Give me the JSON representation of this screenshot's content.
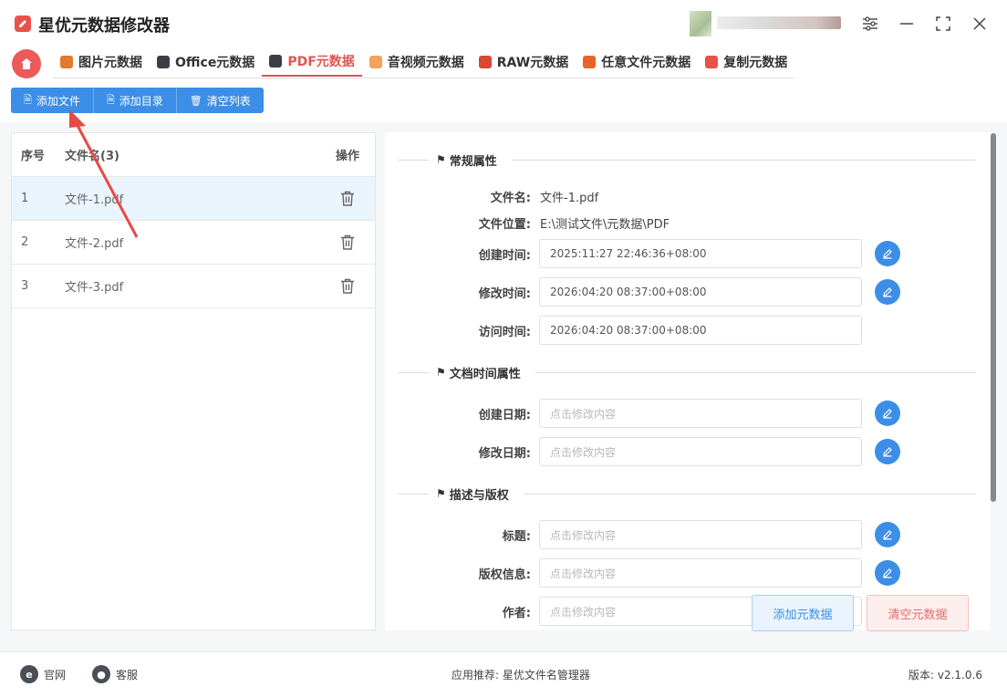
{
  "app": {
    "title": "星优元数据修改器",
    "brand_color": "#e9524a",
    "accent": "#3c8ee6"
  },
  "tabs": [
    {
      "label": "图片元数据",
      "icon": "image-icon",
      "active": false
    },
    {
      "label": "Office元数据",
      "icon": "office-icon",
      "active": false
    },
    {
      "label": "PDF元数据",
      "icon": "pdf-icon",
      "active": true
    },
    {
      "label": "音视频元数据",
      "icon": "media-icon",
      "active": false
    },
    {
      "label": "RAW元数据",
      "icon": "raw-icon",
      "active": false
    },
    {
      "label": "任意文件元数据",
      "icon": "file-icon",
      "active": false
    },
    {
      "label": "复制元数据",
      "icon": "copy-icon",
      "active": false
    }
  ],
  "toolbar": {
    "add_file": "添加文件",
    "add_dir": "添加目录",
    "clear_list": "清空列表"
  },
  "file_list": {
    "headers": {
      "index": "序号",
      "name": "文件名(3)",
      "op": "操作"
    },
    "rows": [
      {
        "index": "1",
        "name": "文件-1.pdf",
        "selected": true
      },
      {
        "index": "2",
        "name": "文件-2.pdf",
        "selected": false
      },
      {
        "index": "3",
        "name": "文件-3.pdf",
        "selected": false
      }
    ]
  },
  "props": {
    "general": {
      "title": "常规属性",
      "filename_label": "文件名:",
      "filename": "文件-1.pdf",
      "location_label": "文件位置:",
      "location": "E:\\测试文件\\元数据\\PDF",
      "created_label": "创建时间:",
      "created": "2025:11:27 22:46:36+08:00",
      "modified_label": "修改时间:",
      "modified": "2026:04:20 08:37:00+08:00",
      "accessed_label": "访问时间:",
      "accessed": "2026:04:20 08:37:00+08:00"
    },
    "doc_time": {
      "title": "文档时间属性",
      "create_date_label": "创建日期:",
      "modify_date_label": "修改日期:",
      "placeholder": "点击修改内容"
    },
    "desc": {
      "title": "描述与版权",
      "title_label": "标题:",
      "copyright_label": "版权信息:",
      "author_label": "作者:",
      "placeholder": "点击修改内容"
    }
  },
  "actions": {
    "add_meta": "添加元数据",
    "clear_meta": "清空元数据"
  },
  "footer": {
    "website": "官网",
    "support": "客服",
    "recommend_label": "应用推荐:",
    "recommend_app": "星优文件名管理器",
    "version_label": "版本:",
    "version": "v2.1.0.6"
  }
}
